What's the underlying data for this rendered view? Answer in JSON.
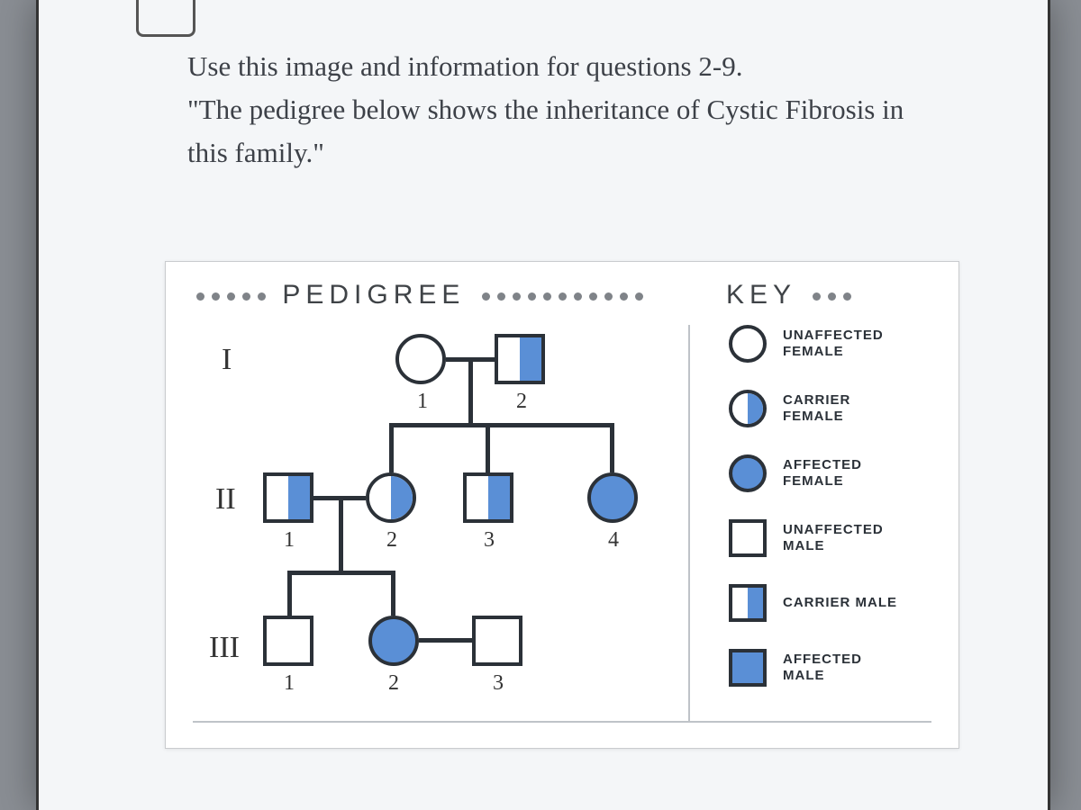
{
  "instructions": {
    "line1": "Use this image and information for questions 2-9.",
    "line2": "\"The pedigree below shows the inheritance of Cystic Fibrosis in this family.\""
  },
  "headers": {
    "pedigree": "PEDIGREE",
    "key": "KEY"
  },
  "generations": {
    "g1": "I",
    "g2": "II",
    "g3": "III"
  },
  "numbers": {
    "n1": "1",
    "n2": "2",
    "n3": "3",
    "n4": "4"
  },
  "key": {
    "unaffected_female": "UNAFFECTED FEMALE",
    "carrier_female": "CARRIER FEMALE",
    "affected_female": "AFFECTED FEMALE",
    "unaffected_male": "UNAFFECTED MALE",
    "carrier_male": "CARRIER MALE",
    "affected_male": "AFFECTED MALE"
  },
  "chart_data": {
    "type": "pedigree",
    "title": "Pedigree — inheritance of Cystic Fibrosis",
    "legend": [
      {
        "symbol": "circle-open",
        "meaning": "unaffected female"
      },
      {
        "symbol": "circle-half",
        "meaning": "carrier female"
      },
      {
        "symbol": "circle-fill",
        "meaning": "affected female"
      },
      {
        "symbol": "square-open",
        "meaning": "unaffected male"
      },
      {
        "symbol": "square-half",
        "meaning": "carrier male"
      },
      {
        "symbol": "square-fill",
        "meaning": "affected male"
      }
    ],
    "individuals": [
      {
        "id": "I-1",
        "gen": "I",
        "pos": 1,
        "sex": "female",
        "status": "unaffected"
      },
      {
        "id": "I-2",
        "gen": "I",
        "pos": 2,
        "sex": "male",
        "status": "carrier"
      },
      {
        "id": "II-1",
        "gen": "II",
        "pos": 1,
        "sex": "male",
        "status": "carrier"
      },
      {
        "id": "II-2",
        "gen": "II",
        "pos": 2,
        "sex": "female",
        "status": "carrier"
      },
      {
        "id": "II-3",
        "gen": "II",
        "pos": 3,
        "sex": "male",
        "status": "carrier"
      },
      {
        "id": "II-4",
        "gen": "II",
        "pos": 4,
        "sex": "female",
        "status": "affected"
      },
      {
        "id": "III-1",
        "gen": "III",
        "pos": 1,
        "sex": "male",
        "status": "unaffected"
      },
      {
        "id": "III-2",
        "gen": "III",
        "pos": 2,
        "sex": "female",
        "status": "affected"
      },
      {
        "id": "III-3",
        "gen": "III",
        "pos": 3,
        "sex": "male",
        "status": "unaffected"
      }
    ],
    "matings": [
      {
        "parents": [
          "I-1",
          "I-2"
        ],
        "children": [
          "II-2",
          "II-3",
          "II-4"
        ]
      },
      {
        "parents": [
          "II-1",
          "II-2"
        ],
        "children": [
          "III-1",
          "III-2"
        ]
      },
      {
        "parents": [
          "III-2",
          "III-3"
        ],
        "children": []
      }
    ]
  }
}
